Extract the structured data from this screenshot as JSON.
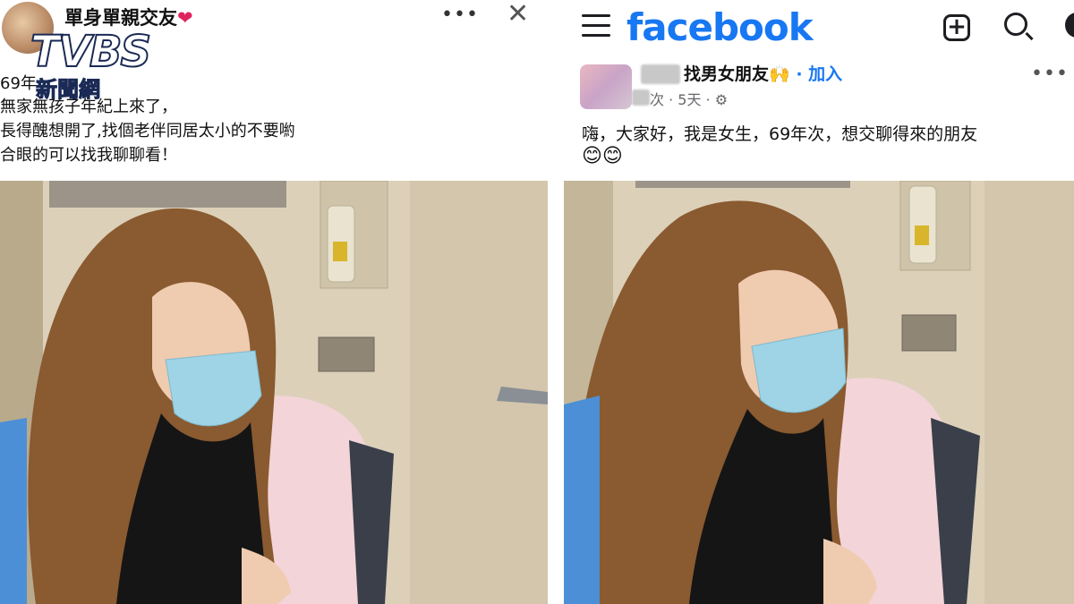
{
  "left_post": {
    "group_name": "單身單親交友",
    "group_heart": "❤",
    "more_icon": "•••",
    "close_icon": "✕",
    "lines": [
      "69年",
      "無家無孩子年紀上來了，",
      "長得醜想開了,找個老伴同居太小的不要喲",
      "合眼的可以找我聊聊看！"
    ]
  },
  "watermark": {
    "brand": "TVBS",
    "subtitle": "新聞網"
  },
  "right_post": {
    "app_logo": "facebook",
    "group_name": "找男女朋友",
    "group_emoji": "🙌",
    "join_label": "· 加入",
    "meta": "次 · 5天 ·",
    "more_icon": "•••",
    "line1": "嗨，大家好，我是女生，69年次，想交聊得來的朋友",
    "line2": "😊😊"
  },
  "colors": {
    "facebook_blue": "#1877f2",
    "text": "#111111",
    "meta": "#65676b"
  }
}
